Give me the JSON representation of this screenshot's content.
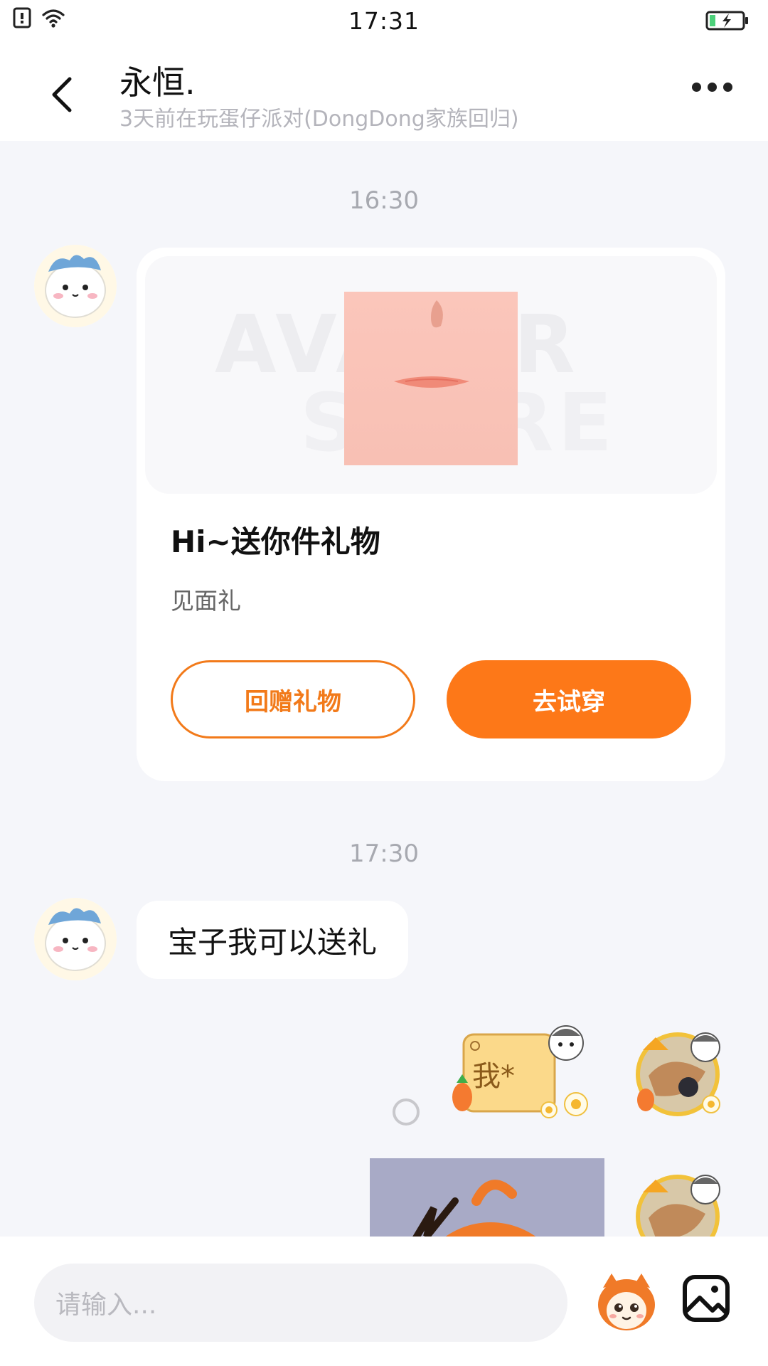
{
  "status_bar": {
    "time": "17:31"
  },
  "header": {
    "contact_name": "永恒.",
    "contact_status": "3天前在玩蛋仔派对(DongDong家族回归)"
  },
  "messages": [
    {
      "timestamp": "16:30"
    },
    {
      "gift_card": {
        "watermark_line1": "AVATAR",
        "watermark_line2": "STORE",
        "title": "Hi~送你件礼物",
        "subtitle": "见面礼",
        "return_gift_label": "回赠礼物",
        "try_on_label": "去试穿"
      }
    },
    {
      "timestamp": "17:30"
    },
    {
      "text": "宝子我可以送礼"
    },
    {
      "sticker_text": "我*"
    }
  ],
  "input": {
    "placeholder": "请输入..."
  },
  "colors": {
    "accent": "#fd7818",
    "accent_outline": "#f27a1a",
    "background": "#f5f6fa"
  }
}
